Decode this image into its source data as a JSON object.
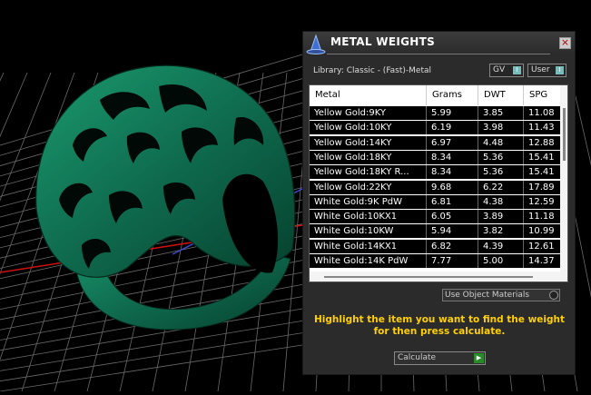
{
  "panel": {
    "title": "METAL WEIGHTS",
    "close_glyph": "×",
    "library_label": "Library: Classic - (Fast)-Metal",
    "gv_toggle": "GV",
    "user_toggle": "User",
    "toggle_knob": "I"
  },
  "table": {
    "columns": [
      "Metal",
      "Grams",
      "DWT",
      "SPG"
    ],
    "rows": [
      [
        "Yellow Gold:9KY",
        "5.99",
        "3.85",
        "11.08"
      ],
      [
        "Yellow Gold:10KY",
        "6.19",
        "3.98",
        "11.43"
      ],
      [
        "Yellow Gold:14KY",
        "6.97",
        "4.48",
        "12.88"
      ],
      [
        "Yellow Gold:18KY",
        "8.34",
        "5.36",
        "15.41"
      ],
      [
        "Yellow Gold:18KY R...",
        "8.34",
        "5.36",
        "15.41"
      ],
      [
        "Yellow Gold:22KY",
        "9.68",
        "6.22",
        "17.89"
      ],
      [
        "White Gold:9K PdW",
        "6.81",
        "4.38",
        "12.59"
      ],
      [
        "White Gold:10KX1",
        "6.05",
        "3.89",
        "11.18"
      ],
      [
        "White Gold:10KW",
        "5.94",
        "3.82",
        "10.99"
      ],
      [
        "White Gold:14KX1",
        "6.82",
        "4.39",
        "12.61"
      ],
      [
        "White Gold:14K PdW",
        "7.77",
        "5.00",
        "14.37"
      ]
    ]
  },
  "use_object_materials": "Use Object Materials",
  "instruction": "Highlight the item you want to find the weight for then press calculate.",
  "calculate": "Calculate",
  "colors": {
    "ring": "#0f6b4e",
    "grid": "#6a6a6a",
    "instruction": "#ffd000"
  }
}
